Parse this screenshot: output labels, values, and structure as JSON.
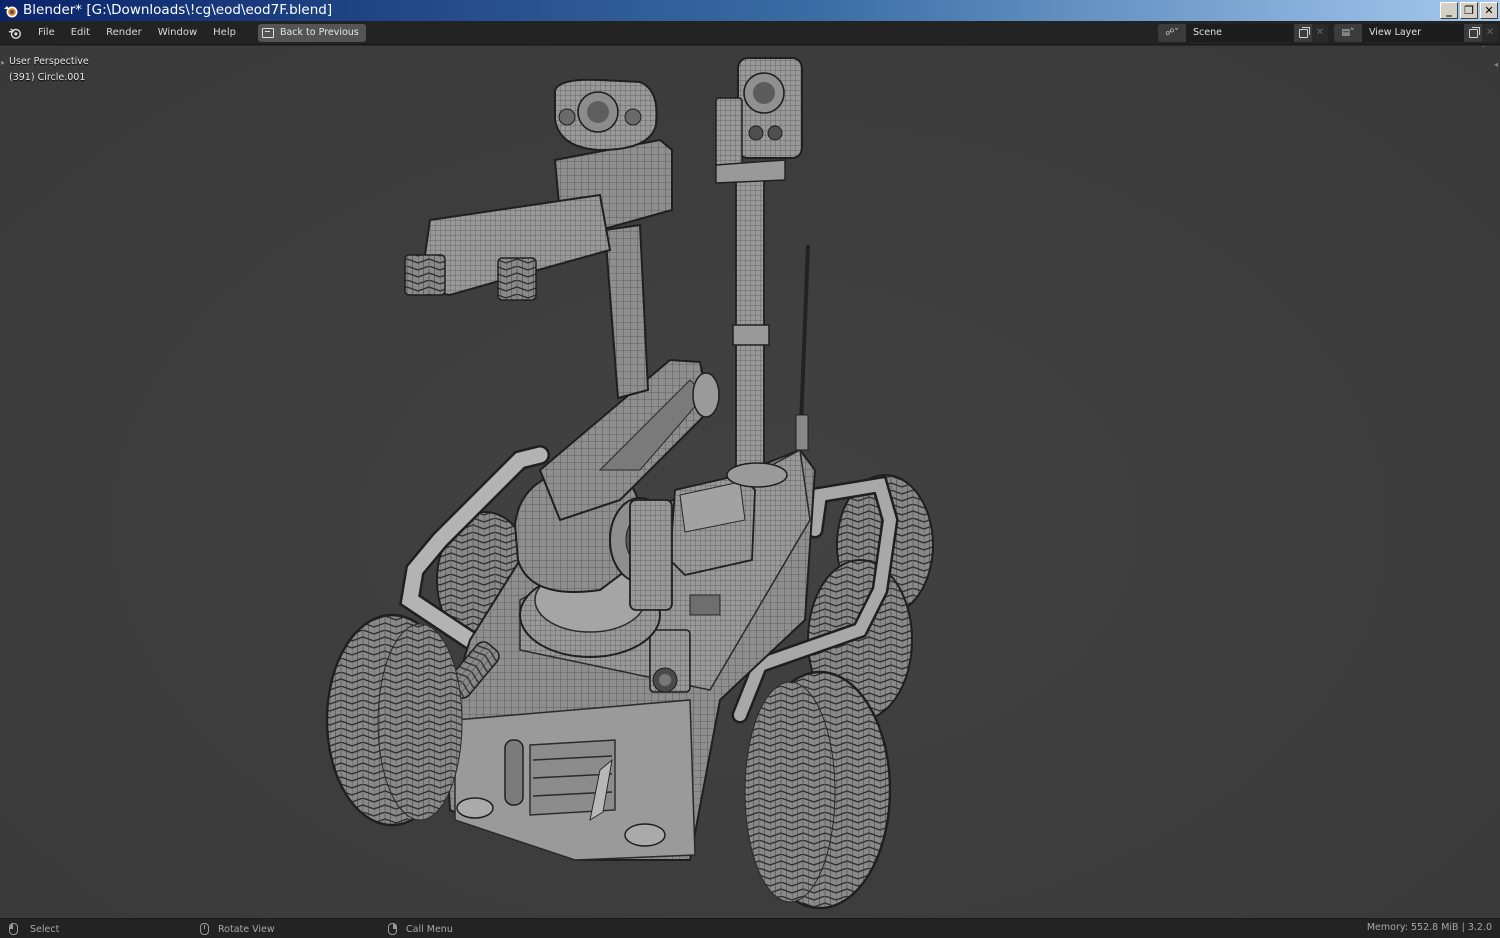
{
  "window": {
    "title": "Blender* [G:\\Downloads\\!cg\\eod\\eod7F.blend]",
    "buttons": [
      "_",
      "❐",
      "✕"
    ]
  },
  "topbar": {
    "menu": [
      "File",
      "Edit",
      "Render",
      "Window",
      "Help"
    ],
    "back_button": "Back to Previous",
    "scene_value": "Scene",
    "view_layer_value": "View Layer"
  },
  "viewport": {
    "view_name": "User Perspective",
    "object_info": "(391) Circle.001"
  },
  "statusbar": {
    "select": "Select",
    "rotate": "Rotate View",
    "call_menu": "Call Menu",
    "memory": "Memory: 552.8 MiB | 3.2.0"
  },
  "colors": {
    "titlebar_start": "#0a246a",
    "topbar_bg": "#232323",
    "viewport_bg": "#3d3d3d",
    "model_fill": "#8f8f8f",
    "wire": "#2a2a2a"
  },
  "icons": [
    "blender-logo-icon",
    "back-icon",
    "scene-icon",
    "view-layer-icon",
    "new-icon",
    "remove-icon",
    "mouse-left-icon",
    "mouse-middle-icon",
    "mouse-right-icon"
  ]
}
